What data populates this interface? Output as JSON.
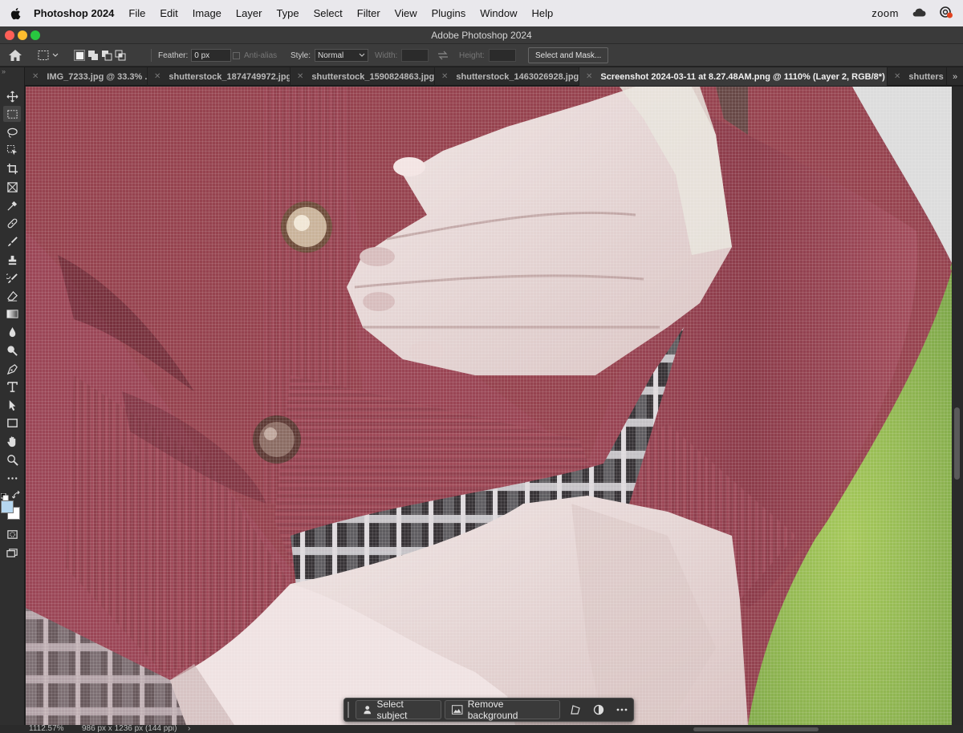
{
  "menubar": {
    "app_name": "Photoshop 2024",
    "items": [
      "File",
      "Edit",
      "Image",
      "Layer",
      "Type",
      "Select",
      "Filter",
      "View",
      "Plugins",
      "Window",
      "Help"
    ],
    "zoom_label": "zoom"
  },
  "window": {
    "title": "Adobe Photoshop 2024"
  },
  "options": {
    "feather_label": "Feather:",
    "feather_value": "0 px",
    "anti_alias_label": "Anti-alias",
    "style_label": "Style:",
    "style_value": "Normal",
    "width_label": "Width:",
    "height_label": "Height:",
    "select_mask_label": "Select and Mask..."
  },
  "tabs": [
    {
      "label": "IMG_7233.jpg @ 33.3% ..."
    },
    {
      "label": "shutterstock_1874749972.jpg"
    },
    {
      "label": "shutterstock_1590824863.jpg"
    },
    {
      "label": "shutterstock_1463026928.jpg"
    },
    {
      "label": "Screenshot 2024-03-11 at 8.27.48AM.png @ 1110% (Layer 2, RGB/8*) *",
      "active": true
    },
    {
      "label": "shutters"
    }
  ],
  "tools": [
    "move-tool-icon",
    "marquee-tool-icon",
    "lasso-tool-icon",
    "object-selection-tool-icon",
    "crop-tool-icon",
    "frame-tool-icon",
    "eyedropper-tool-icon",
    "healing-brush-tool-icon",
    "brush-tool-icon",
    "clone-stamp-tool-icon",
    "history-brush-tool-icon",
    "eraser-tool-icon",
    "gradient-tool-icon",
    "blur-tool-icon",
    "dodge-tool-icon",
    "pen-tool-icon",
    "type-tool-icon",
    "path-selection-tool-icon",
    "rectangle-tool-icon",
    "hand-tool-icon",
    "zoom-tool-icon",
    "more-tools-icon"
  ],
  "colors": {
    "foreground": "#000000",
    "background_swatch": "#b6d7f0",
    "sweater": "#93424f",
    "grass": "#94b74e"
  },
  "taskbar": {
    "select_subject_label": "Select subject",
    "remove_background_label": "Remove background"
  },
  "status": {
    "zoom": "1112.57%",
    "doc_info": "986 px x 1236 px (144 ppi)",
    "arrow": "›"
  }
}
